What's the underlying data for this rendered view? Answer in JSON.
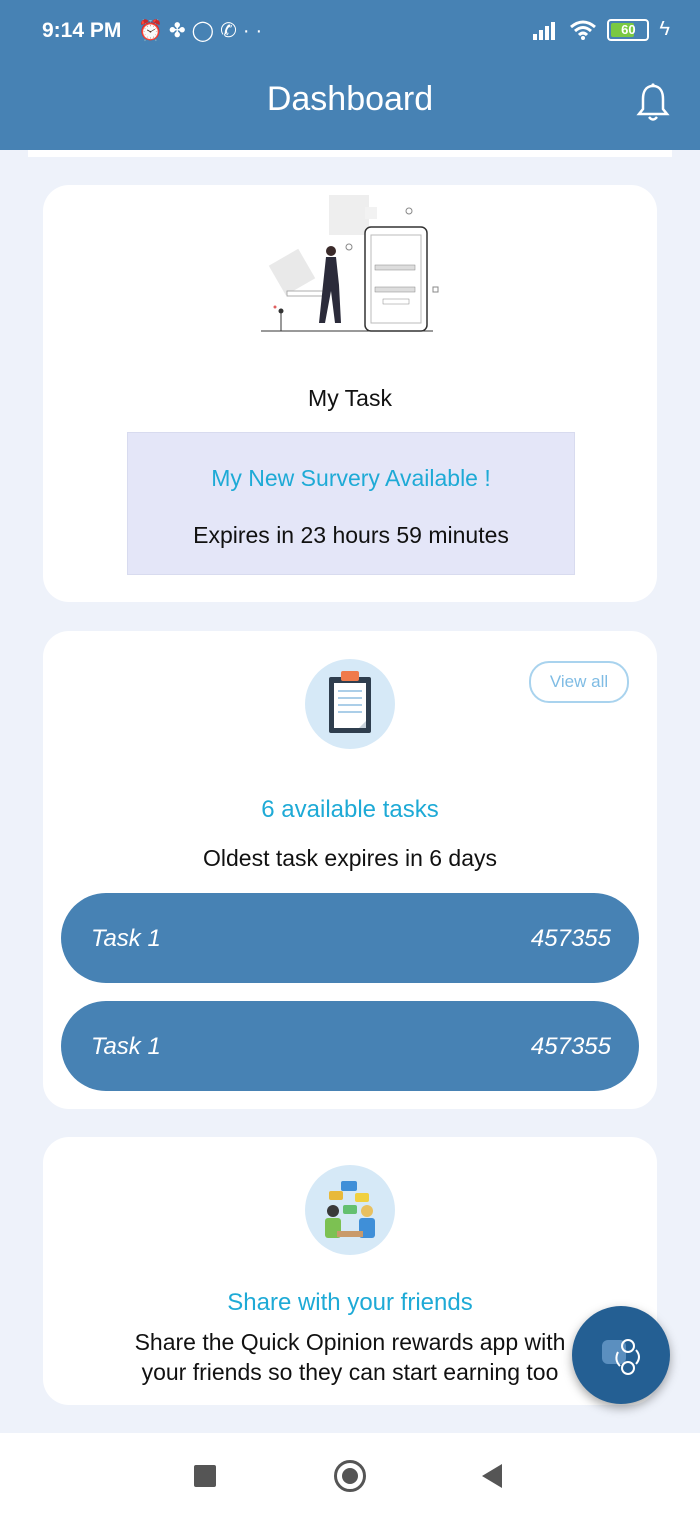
{
  "status_bar": {
    "time": "9:14 PM",
    "left_icons": [
      "alarm-icon",
      "fan-icon",
      "circle-icon",
      "call-icon",
      "more-dots-icon"
    ],
    "battery": "60",
    "right_icons": [
      "signal-icon",
      "wifi-icon",
      "battery-icon",
      "charging-icon"
    ]
  },
  "app_bar": {
    "title": "Dashboard",
    "icon": "bell-icon"
  },
  "my_task_card": {
    "heading": "My Task",
    "survey_title": "My New Survery Available !",
    "survey_expiry": "Expires in 23 hours 59 minutes"
  },
  "tasks_card": {
    "view_all": "View all",
    "count_text": "6 available tasks",
    "oldest_text": "Oldest task expires in 6 days",
    "tasks": [
      {
        "name": "Task 1",
        "value": "457355"
      },
      {
        "name": "Task 1",
        "value": "457355"
      }
    ]
  },
  "share_card": {
    "title": "Share with your friends",
    "text": "Share the Quick Opinion rewards app with\nyour friends so they can start earning too"
  },
  "colors": {
    "primary": "#4782b4",
    "accent_text": "#1eaad6",
    "fab": "#245f93",
    "background": "#eef2fa"
  },
  "nav_bar": {
    "icons": [
      "recents-icon",
      "home-icon",
      "back-icon"
    ]
  }
}
